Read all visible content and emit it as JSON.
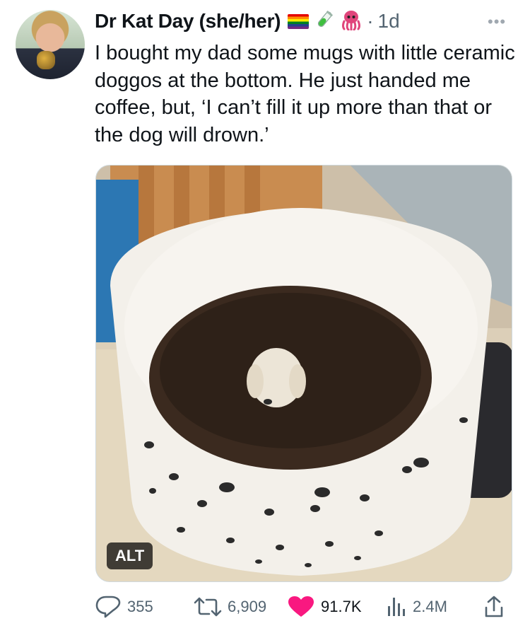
{
  "author": {
    "display_name": "Dr Kat Day (she/her)",
    "badges": [
      "rainbow-flag-emoji",
      "test-tube-emoji",
      "octopus-emoji"
    ],
    "timestamp": "1d"
  },
  "tweet": {
    "text": "I bought my dad some mugs with little ceramic doggos at the bottom. He just handed me coffee, but, ‘I can’t fill it up more than that or the dog will drown.’"
  },
  "media": {
    "alt_label": "ALT"
  },
  "actions": {
    "replies": "355",
    "retweets": "6,909",
    "likes": "91.7K",
    "views": "2.4M"
  },
  "colors": {
    "text_primary": "#0f1419",
    "text_secondary": "#536471",
    "like_red": "#f91880"
  },
  "icons": {
    "more": "more-dots-icon",
    "reply": "reply-icon",
    "retweet": "retweet-icon",
    "like": "heart-icon",
    "views": "views-chart-icon",
    "share": "share-icon"
  }
}
